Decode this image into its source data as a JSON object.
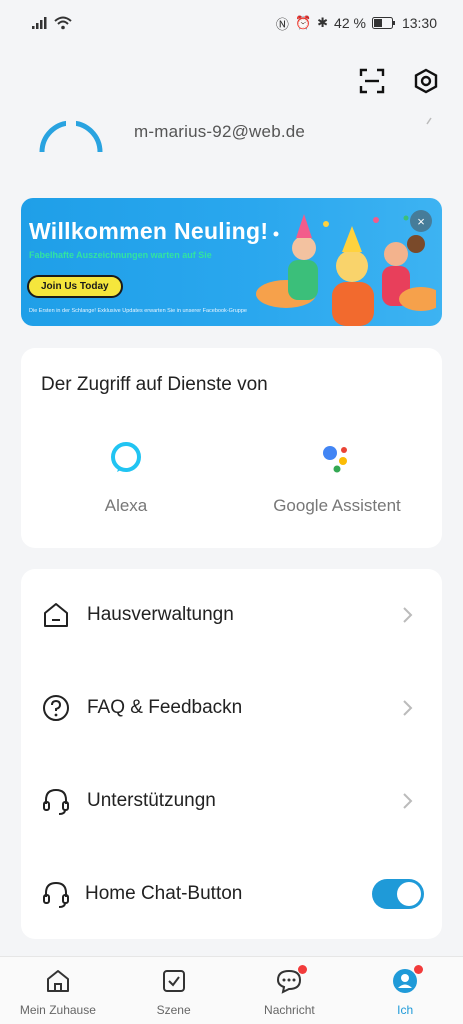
{
  "status_bar": {
    "battery": "42 %",
    "time": "13:30"
  },
  "profile": {
    "email": "m-marius-92@web.de"
  },
  "banner": {
    "title": "Willkommen Neuling!",
    "subtitle": "Fabelhafte Auszeichnungen warten auf Sie",
    "button": "Join Us Today",
    "footnote": "Die Ersten in der Schlange! Exklusive Updates erwarten Sie in unserer Facebook-Gruppe"
  },
  "services": {
    "title": "Der Zugriff auf Dienste von",
    "items": [
      {
        "label": "Alexa",
        "icon": "alexa-icon"
      },
      {
        "label": "Google Assistent",
        "icon": "google-assistant-icon"
      }
    ]
  },
  "menu": {
    "items": [
      {
        "label": "Hausverwaltungn",
        "icon": "house-icon"
      },
      {
        "label": "FAQ & Feedbackn",
        "icon": "question-icon"
      },
      {
        "label": "Unterstützungn",
        "icon": "headset-icon"
      },
      {
        "label": "Home Chat-Button",
        "icon": "headset-icon",
        "toggle": true
      }
    ]
  },
  "tabs": [
    {
      "label": "Mein Zuhause",
      "icon": "home-icon"
    },
    {
      "label": "Szene",
      "icon": "checkbox-icon"
    },
    {
      "label": "Nachricht",
      "icon": "chat-icon",
      "badge": true
    },
    {
      "label": "Ich",
      "icon": "user-icon",
      "active": true,
      "badge": true
    }
  ],
  "colors": {
    "accent": "#1f9ad8",
    "badge": "#f23b3b",
    "banner": "#2aa7ee"
  }
}
